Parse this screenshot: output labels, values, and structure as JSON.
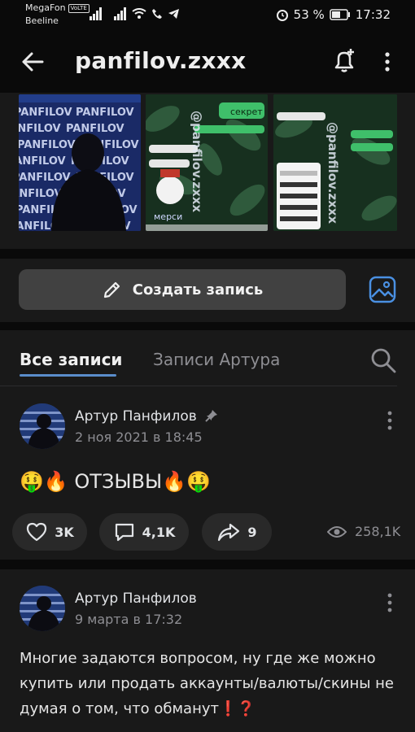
{
  "status_bar": {
    "carrier1": "MegaFon",
    "volte": "VoLTE",
    "carrier2": "Beeline",
    "battery": "53 %",
    "time": "17:32"
  },
  "header": {
    "title": "panfilov.zxxx"
  },
  "photos": {
    "p1_text": "PANFILOV",
    "p2_bubble": "секрет",
    "p2_sticker": "мерси",
    "p2_watermark": "@panfilov.zxxx",
    "p3_watermark": "@panfilov.zxxx"
  },
  "create_post": {
    "label": "Создать запись"
  },
  "tabs": {
    "all": "Все записи",
    "author": "Записи Артура"
  },
  "posts": [
    {
      "author": "Артур Панфилов",
      "date": "2 ноя 2021 в 18:45",
      "text": "🤑🔥 ОТЗЫВЫ🔥🤑",
      "likes": "3K",
      "comments": "4,1K",
      "shares": "9",
      "views": "258,1K"
    },
    {
      "author": "Артур Панфилов",
      "date": "9 марта в 17:32",
      "text": "Многие задаются вопросом, ну где же можно купить или продать аккаунты/валюты/скины не думая о том, что обманут❗❓"
    }
  ]
}
